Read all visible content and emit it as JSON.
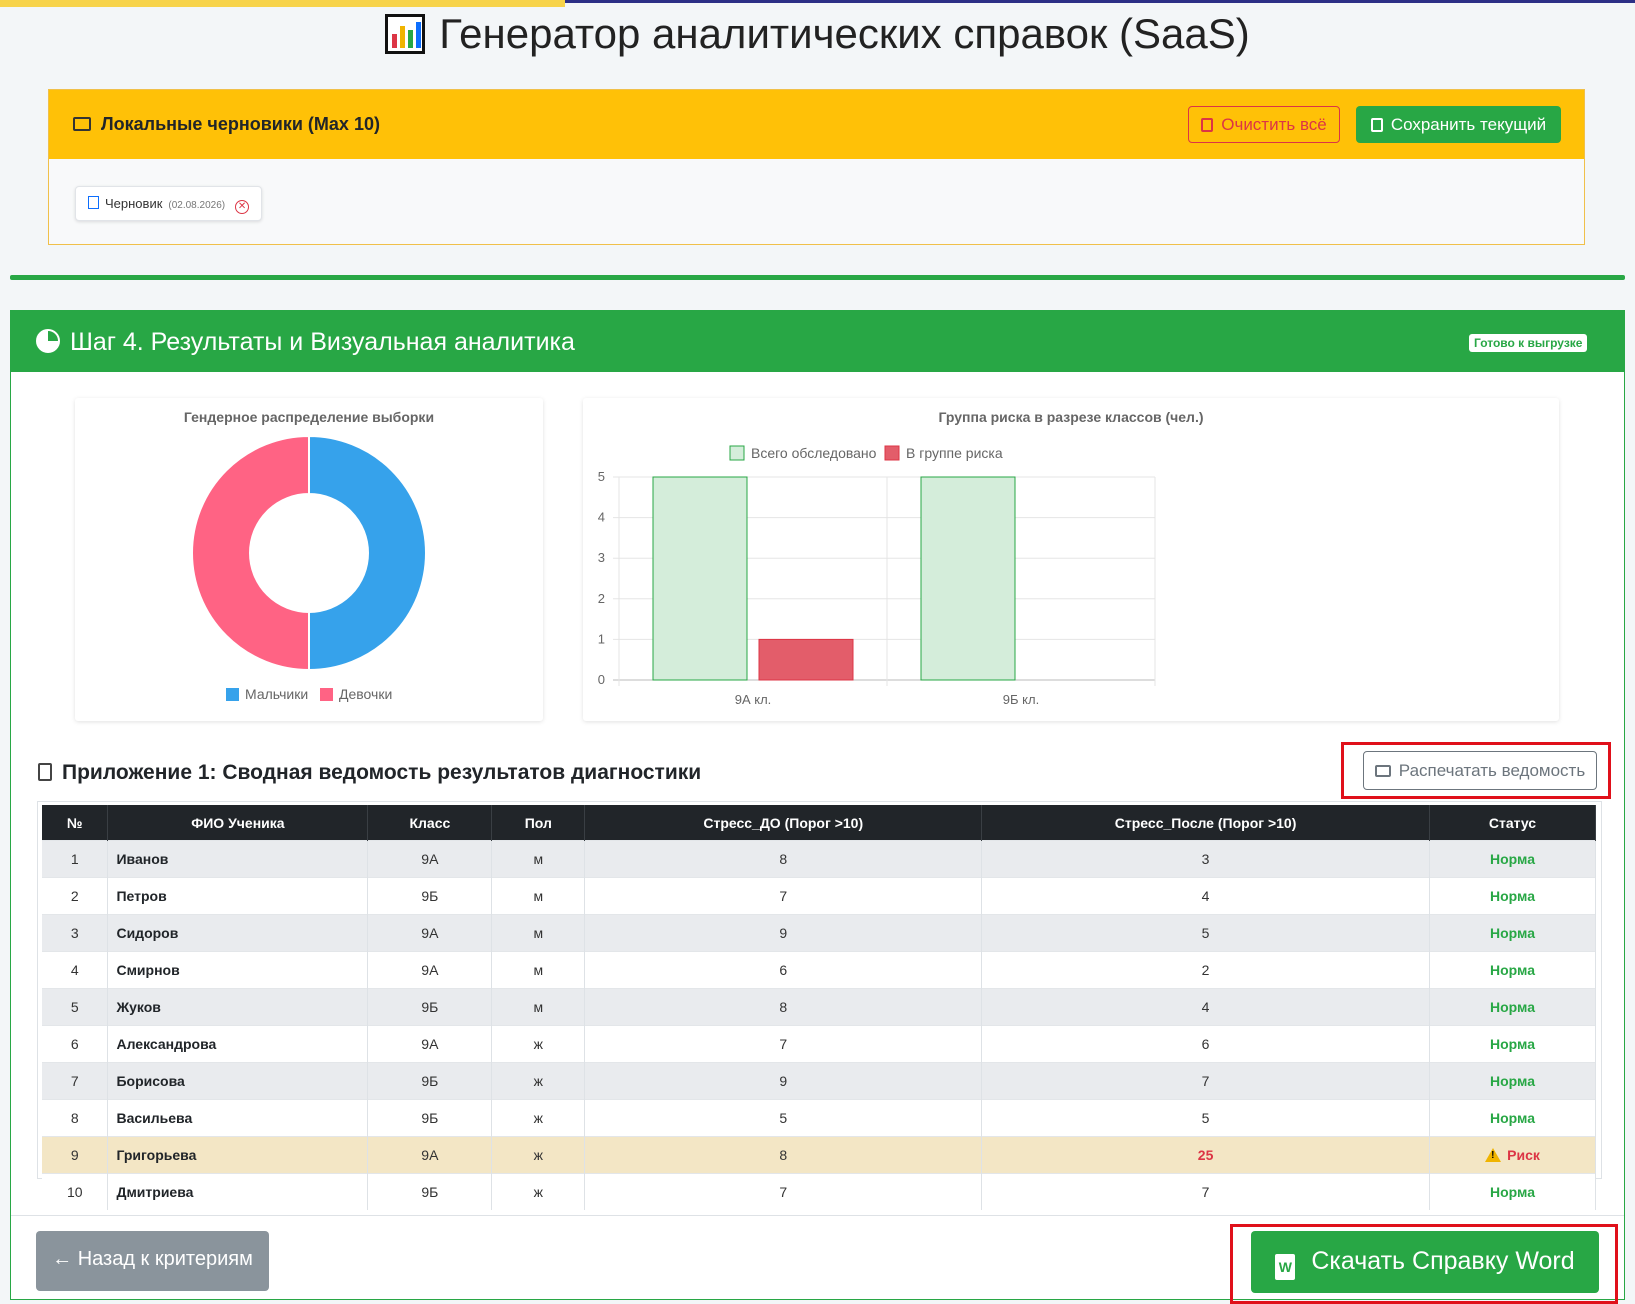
{
  "app": {
    "title": "Генератор аналитических справок (SaaS)"
  },
  "drafts": {
    "title": "Локальные черновики (Max 10)",
    "clear_label": "Очистить всё",
    "save_label": "Сохранить текущий",
    "items": [
      {
        "name": "Черновик",
        "date": "(02.08.2026)"
      }
    ]
  },
  "step": {
    "title": "Шаг 4. Результаты и Визуальная аналитика",
    "badge": "Готово к выгрузке"
  },
  "chart_data": [
    {
      "type": "pie",
      "title": "Гендерное распределение выборки",
      "labels": [
        "Мальчики",
        "Девочки"
      ],
      "values": [
        5,
        5
      ],
      "colors": [
        "#36a2eb",
        "#ff6384"
      ],
      "doughnut": true,
      "legend": "bottom"
    },
    {
      "type": "bar",
      "title": "Группа риска в разрезе классов (чел.)",
      "categories": [
        "9А кл.",
        "9Б кл."
      ],
      "series": [
        {
          "name": "Всего обследовано",
          "values": [
            5,
            5
          ],
          "color": "#d4edda",
          "border": "#28a745"
        },
        {
          "name": "В группе риска",
          "values": [
            1,
            0
          ],
          "color": "#e35d6a",
          "border": "#dc3545"
        }
      ],
      "ylim": [
        0,
        5
      ],
      "yticks": [
        0,
        1,
        2,
        3,
        4,
        5
      ],
      "legend": "top",
      "grid": true
    }
  ],
  "table": {
    "title": "Приложение 1: Сводная ведомость результатов диагностики",
    "print_label": "Распечатать ведомость",
    "columns": [
      "№",
      "ФИО Ученика",
      "Класс",
      "Пол",
      "Стресс_ДО (Порог >10)",
      "Стресс_После (Порог >10)",
      "Статус"
    ],
    "rows": [
      [
        "1",
        "Иванов",
        "9А",
        "м",
        "8",
        "3",
        "Норма"
      ],
      [
        "2",
        "Петров",
        "9Б",
        "м",
        "7",
        "4",
        "Норма"
      ],
      [
        "3",
        "Сидоров",
        "9А",
        "м",
        "9",
        "5",
        "Норма"
      ],
      [
        "4",
        "Смирнов",
        "9А",
        "м",
        "6",
        "2",
        "Норма"
      ],
      [
        "5",
        "Жуков",
        "9Б",
        "м",
        "8",
        "4",
        "Норма"
      ],
      [
        "6",
        "Александрова",
        "9А",
        "ж",
        "7",
        "6",
        "Норма"
      ],
      [
        "7",
        "Борисова",
        "9Б",
        "ж",
        "9",
        "7",
        "Норма"
      ],
      [
        "8",
        "Васильева",
        "9Б",
        "ж",
        "5",
        "5",
        "Норма"
      ],
      [
        "9",
        "Григорьева",
        "9А",
        "ж",
        "8",
        "25",
        "Риск"
      ],
      [
        "10",
        "Дмитриева",
        "9Б",
        "ж",
        "7",
        "7",
        "Норма"
      ]
    ],
    "risk_rows": [
      9
    ]
  },
  "footer": {
    "back_label": "← Назад к критериям",
    "download_label": "Скачать Справку Word"
  }
}
